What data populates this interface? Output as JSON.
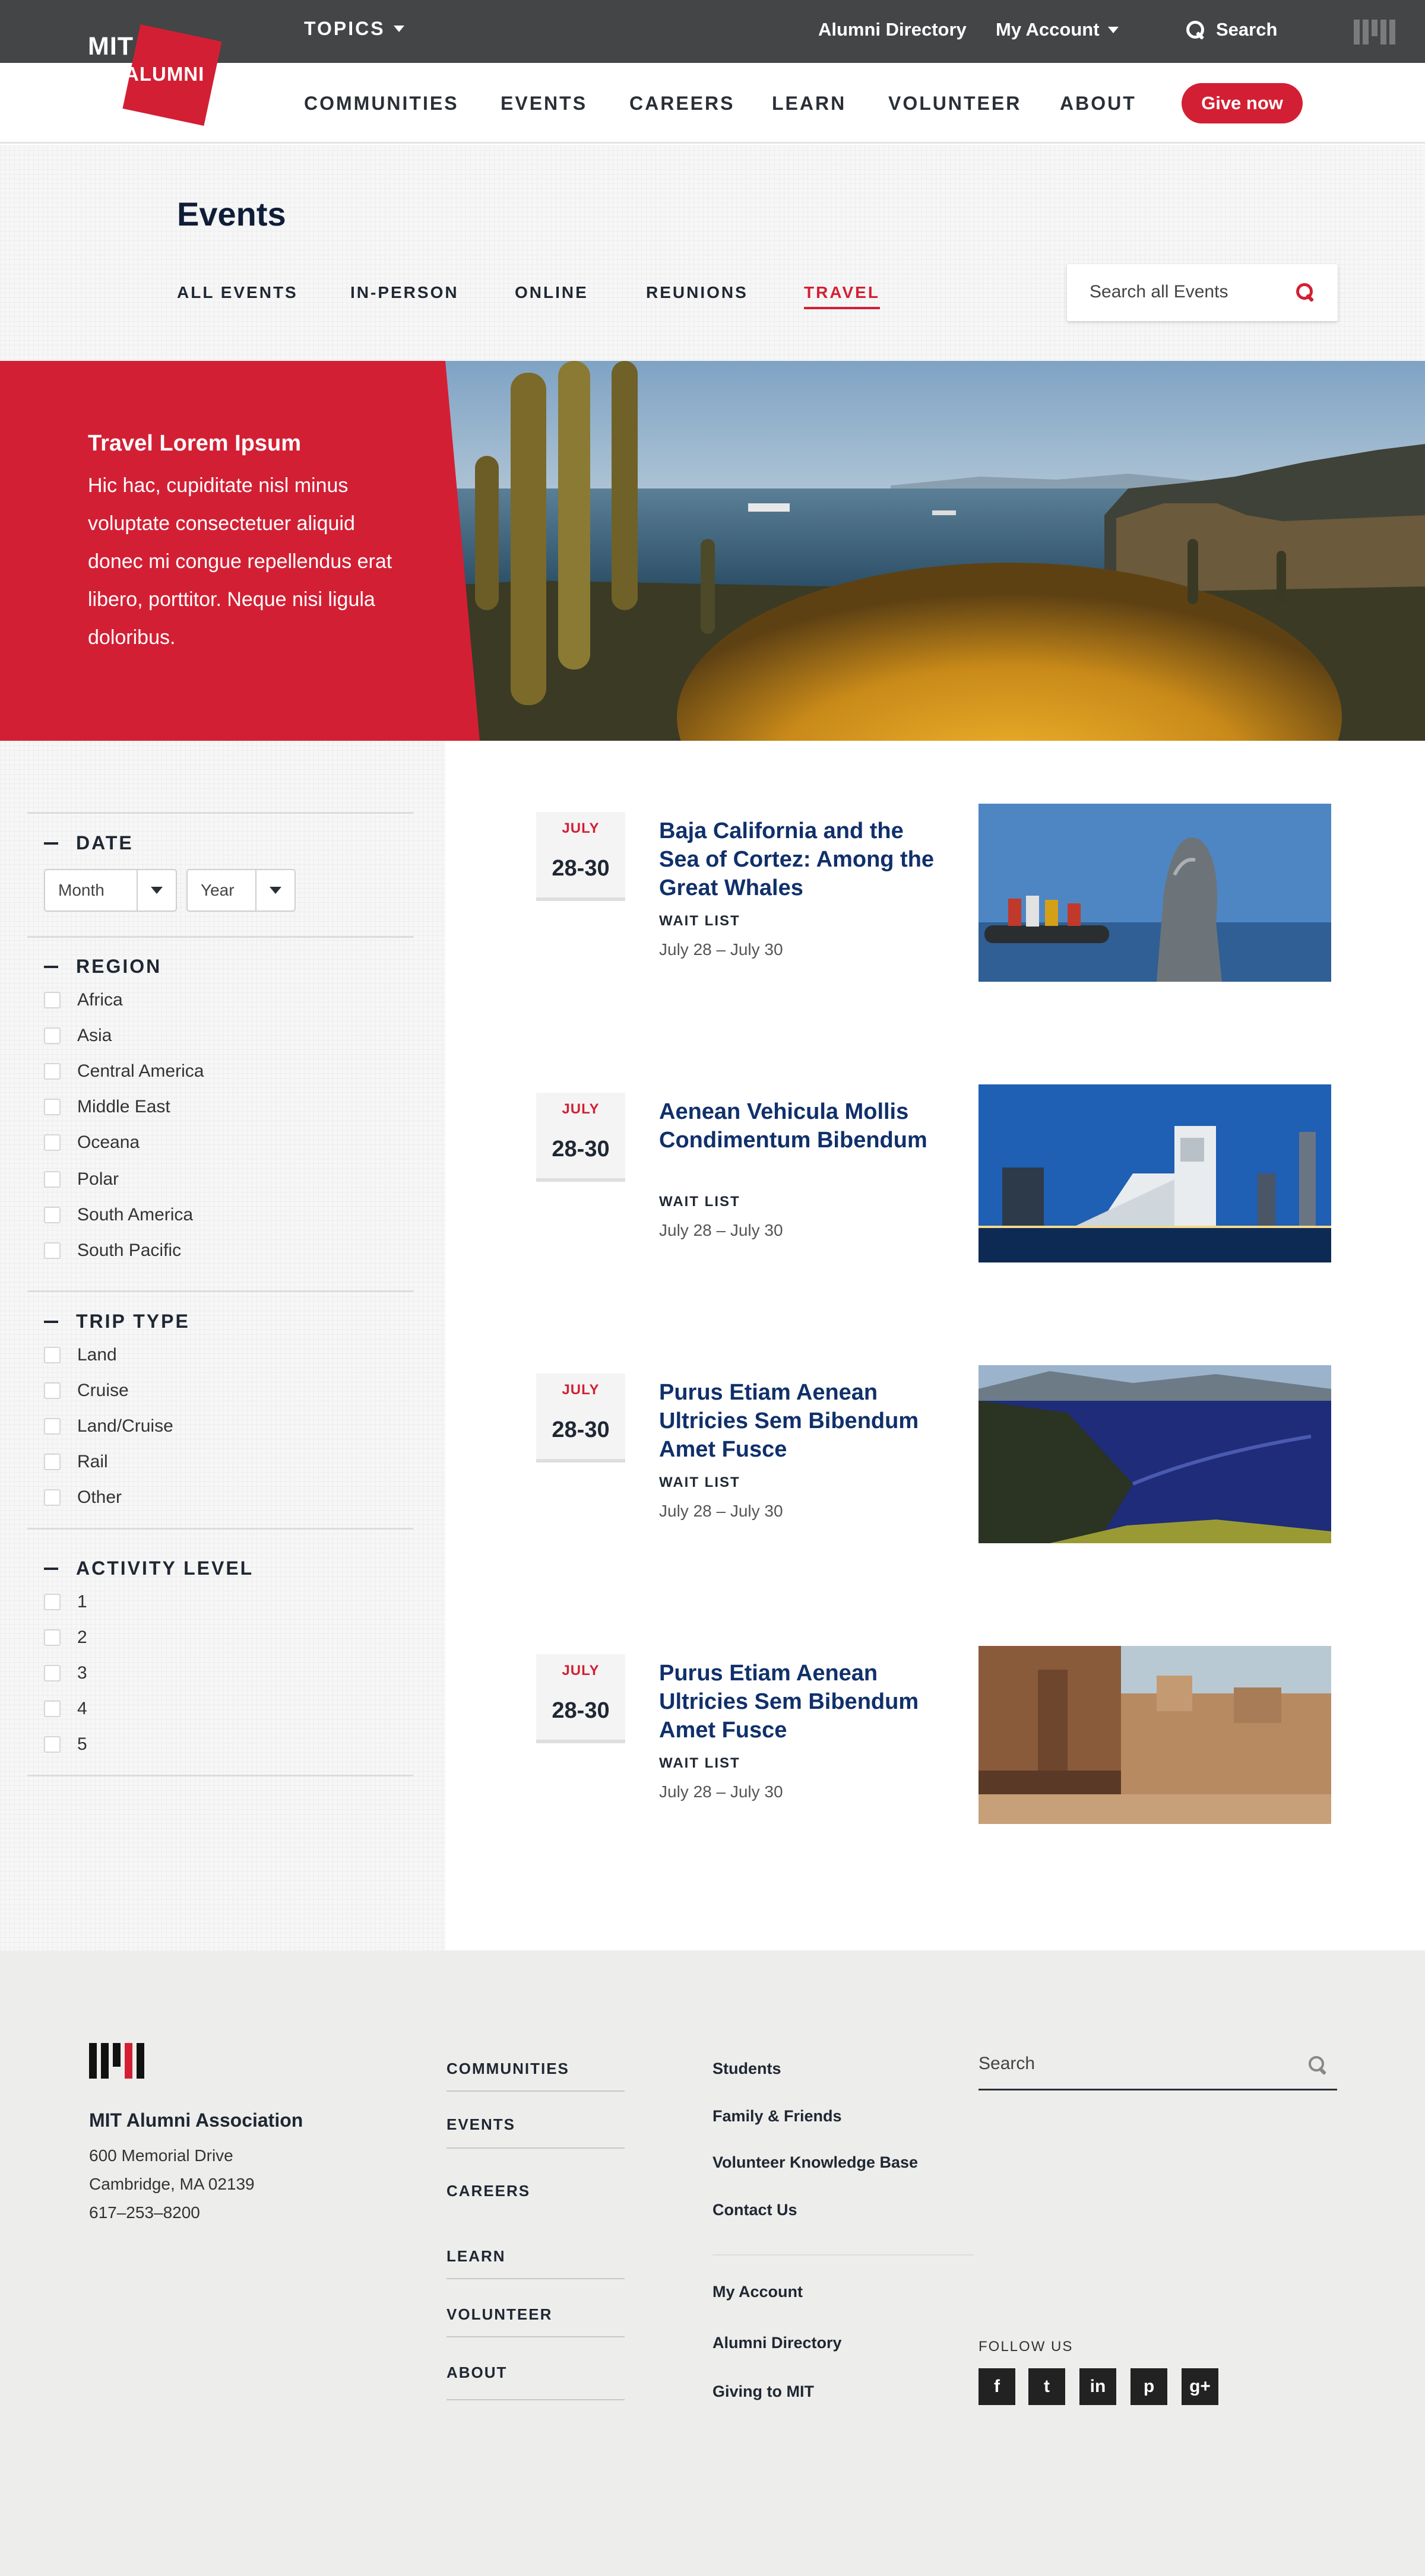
{
  "topbar": {
    "topics_label": "TOPICS",
    "alumni_directory": "Alumni Directory",
    "my_account": "My Account",
    "search_label": "Search"
  },
  "logo": {
    "line1": "MIT",
    "line2": "ALUMNI"
  },
  "nav": {
    "items": [
      "COMMUNITIES",
      "EVENTS",
      "CAREERS",
      "LEARN",
      "VOLUNTEER",
      "ABOUT"
    ],
    "give_label": "Give now"
  },
  "events": {
    "title": "Events",
    "tabs": [
      "ALL EVENTS",
      "IN-PERSON",
      "ONLINE",
      "REUNIONS",
      "TRAVEL"
    ],
    "active_tab": "TRAVEL",
    "search_placeholder": "Search all Events"
  },
  "hero": {
    "title": "Travel Lorem Ipsum",
    "text": "Hic hac, cupiditate nisl minus voluptate consectetuer aliquid donec mi congue repellendus erat libero, porttitor. Neque nisi ligula doloribus."
  },
  "filters": {
    "date": {
      "heading": "DATE",
      "month": "Month",
      "year": "Year"
    },
    "region": {
      "heading": "REGION",
      "options": [
        "Africa",
        "Asia",
        "Central America",
        "Middle East",
        "Oceana",
        "Polar",
        "South America",
        "South Pacific"
      ]
    },
    "trip_type": {
      "heading": "TRIP TYPE",
      "options": [
        "Land",
        "Cruise",
        "Land/Cruise",
        "Rail",
        "Other"
      ]
    },
    "activity_level": {
      "heading": "ACTIVITY LEVEL",
      "options": [
        "1",
        "2",
        "3",
        "4",
        "5"
      ]
    }
  },
  "event_list": [
    {
      "month": "JULY",
      "days": "28-30",
      "title": "Baja California and the Sea of Cortez: Among the Great Whales",
      "status": "WAIT LIST",
      "range": "July 28 – July 30"
    },
    {
      "month": "JULY",
      "days": "28-30",
      "title": "Aenean Vehicula Mollis Condimentum Bibendum",
      "status": "WAIT LIST",
      "range": "July 28 – July 30"
    },
    {
      "month": "JULY",
      "days": "28-30",
      "title": "Purus Etiam Aenean Ultricies Sem Bibendum Amet Fusce",
      "status": "WAIT LIST",
      "range": "July 28 – July 30"
    },
    {
      "month": "JULY",
      "days": "28-30",
      "title": "Purus Etiam Aenean Ultricies Sem Bibendum Amet Fusce",
      "status": "WAIT LIST",
      "range": "July 28 – July 30"
    }
  ],
  "footer": {
    "org": "MIT Alumni Association",
    "address": [
      "600 Memorial Drive",
      "Cambridge, MA 02139",
      "617–253–8200"
    ],
    "nav": [
      "COMMUNITIES",
      "EVENTS",
      "CAREERS",
      "LEARN",
      "VOLUNTEER",
      "ABOUT"
    ],
    "links_a": [
      "Students",
      "Family & Friends",
      "Volunteer Knowledge Base",
      "Contact Us"
    ],
    "links_b": [
      "My Account",
      "Alumni Directory",
      "Giving to MIT"
    ],
    "search_placeholder": "Search",
    "follow_label": "FOLLOW US",
    "social": [
      "f",
      "t",
      "in",
      "p",
      "g+"
    ]
  },
  "colors": {
    "accent": "#d31f34",
    "title_blue": "#10306b",
    "topbar": "#444546",
    "footer_bg": "#ededeb"
  },
  "icons": [
    "search-icon",
    "caret-down-icon",
    "mit-logo-icon",
    "facebook-icon",
    "twitter-icon",
    "linkedin-icon",
    "pinterest-icon",
    "google-plus-icon",
    "checkbox-icon",
    "minus-icon"
  ]
}
